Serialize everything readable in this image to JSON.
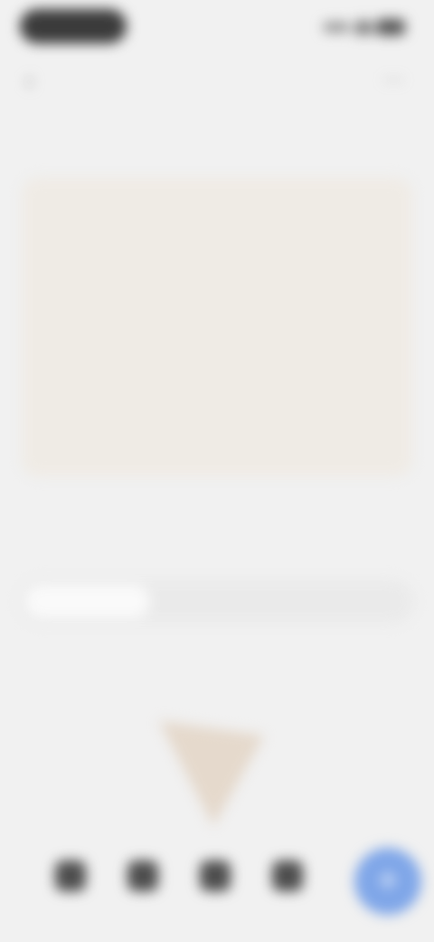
{
  "status_bar": {
    "icons": [
      "signal-icon",
      "wifi-icon",
      "battery-icon"
    ]
  },
  "nav": {
    "title": "",
    "back_icon": "chevron-left-icon",
    "more_icon": "more-icon"
  },
  "summary": {
    "title": "",
    "link": "",
    "stats": [
      {
        "label": "",
        "value": ""
      },
      {
        "label": "",
        "value": ""
      },
      {
        "label": "",
        "value": ""
      },
      {
        "label": "",
        "value": ""
      },
      {
        "label": "",
        "value": ""
      }
    ]
  },
  "trend": {
    "title": "",
    "link": "",
    "tabs": [
      {
        "label": "",
        "active": true
      },
      {
        "label": "",
        "active": false
      },
      {
        "label": "",
        "active": false
      }
    ]
  },
  "chart_data": {
    "type": "line",
    "title": "",
    "x": [],
    "series": [],
    "colors": {
      "fill": "#e3d6c8",
      "stroke": "#d3c2ae"
    }
  },
  "bottom_bar": {
    "left_caption": "",
    "right_caption": "",
    "tabs": [
      {
        "label": "",
        "icon": "home-icon"
      },
      {
        "label": "",
        "icon": "list-icon"
      },
      {
        "label": "",
        "icon": "chart-icon"
      },
      {
        "label": "",
        "icon": "profile-icon"
      }
    ],
    "fab_icon": "plus-icon",
    "fab_color": "#7fa6e8"
  }
}
